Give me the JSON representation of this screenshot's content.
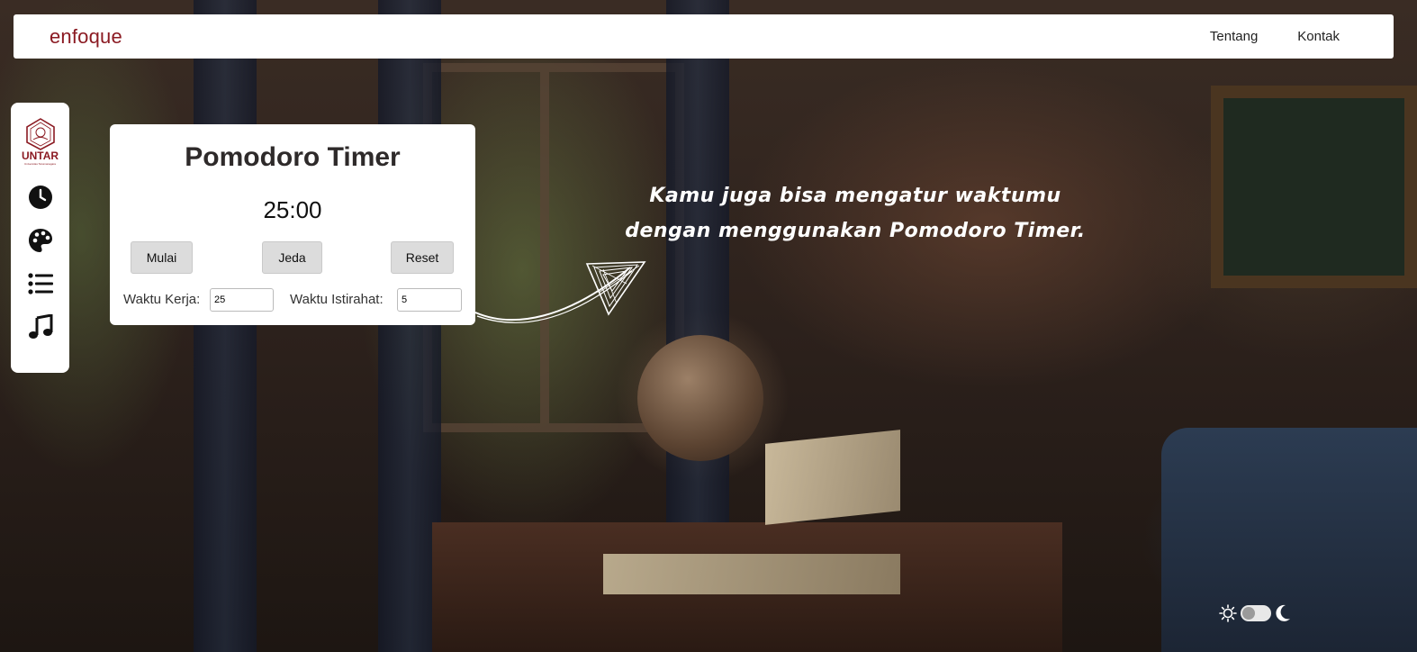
{
  "navbar": {
    "brand": "enfoque",
    "links": [
      "Tentang",
      "Kontak"
    ]
  },
  "sidebar": {
    "logo_text": "UNTAR",
    "logo_sub": "Universitas Tarumanagara",
    "icons": [
      "clock-icon",
      "palette-icon",
      "list-icon",
      "music-icon"
    ]
  },
  "timer": {
    "title": "Pomodoro Timer",
    "display": "25:00",
    "start_label": "Mulai",
    "pause_label": "Jeda",
    "reset_label": "Reset",
    "work_label": "Waktu Kerja:",
    "work_value": "25",
    "break_label": "Waktu Istirahat:",
    "break_value": "5"
  },
  "headline": {
    "line1": "Kamu juga bisa mengatur waktumu",
    "line2": "dengan menggunakan Pomodoro Timer."
  },
  "theme": {
    "light_icon": "sun-icon",
    "dark_icon": "moon-icon",
    "mode": "light"
  },
  "colors": {
    "brand": "#8b1a22",
    "card": "#ffffff",
    "button": "#dcdcdc"
  }
}
